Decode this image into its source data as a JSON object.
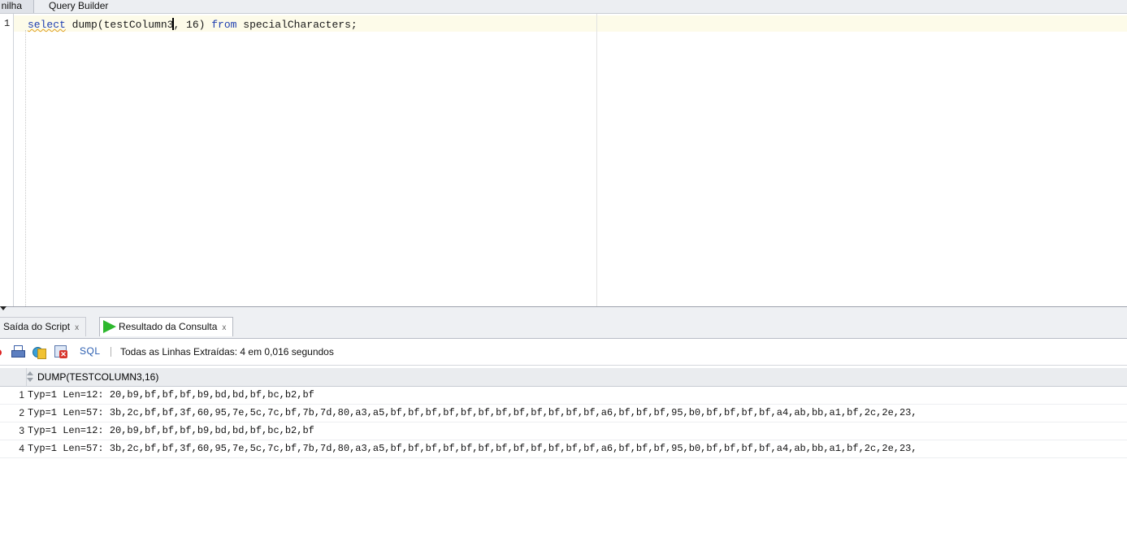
{
  "top_tabs": {
    "worksheet_label": "nilha",
    "query_builder_label": "Query Builder"
  },
  "editor": {
    "line_number": "1",
    "code": {
      "kw_select": "select",
      "part1": " dump(testColumn3",
      "part2": ", 16) ",
      "kw_from": "from",
      "part3": " specialCharacters;"
    }
  },
  "bottom_tabs": {
    "script_output_label": "Saída do Script",
    "query_result_label": "Resultado da Consulta",
    "close_glyph": "x"
  },
  "toolbar": {
    "sql_label": "SQL",
    "status": "Todas as Linhas Extraídas: 4 em 0,016 segundos"
  },
  "results": {
    "column_header": "DUMP(TESTCOLUMN3,16)",
    "rows": [
      {
        "num": "1",
        "value": "Typ=1 Len=12: 20,b9,bf,bf,bf,b9,bd,bd,bf,bc,b2,bf"
      },
      {
        "num": "2",
        "value": "Typ=1 Len=57: 3b,2c,bf,bf,3f,60,95,7e,5c,7c,bf,7b,7d,80,a3,a5,bf,bf,bf,bf,bf,bf,bf,bf,bf,bf,bf,bf,a6,bf,bf,bf,95,b0,bf,bf,bf,bf,a4,ab,bb,a1,bf,2c,2e,23,"
      },
      {
        "num": "3",
        "value": "Typ=1 Len=12: 20,b9,bf,bf,bf,b9,bd,bd,bf,bc,b2,bf"
      },
      {
        "num": "4",
        "value": "Typ=1 Len=57: 3b,2c,bf,bf,3f,60,95,7e,5c,7c,bf,7b,7d,80,a3,a5,bf,bf,bf,bf,bf,bf,bf,bf,bf,bf,bf,bf,a6,bf,bf,bf,95,b0,bf,bf,bf,bf,a4,ab,bb,a1,bf,2c,2e,23,"
      }
    ]
  },
  "icons": {
    "pin": "pin-icon",
    "print": "print-icon",
    "refresh": "refresh-icon",
    "delete": "delete-icon",
    "run": "run-query-icon",
    "sort": "sort-icon"
  },
  "colors": {
    "keyword": "#1f3fb0",
    "run_green": "#2db82d",
    "current_line": "#fdfbe9"
  }
}
